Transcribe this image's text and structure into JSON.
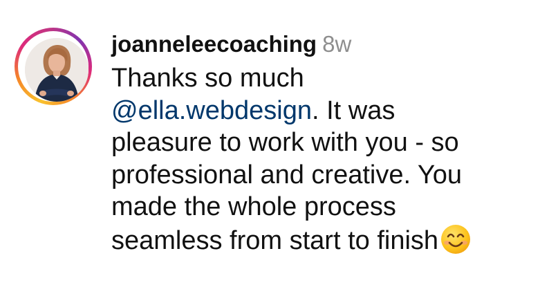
{
  "comment": {
    "username": "joanneleecoaching",
    "timestamp": "8w",
    "avatar_icon": "profile-photo-avatar",
    "line1": "Thanks so much",
    "mention": "@ella.webdesign",
    "line2_rest": ". It was",
    "line3": "pleasure to work with you - so",
    "line4": "professional and creative. You",
    "line5": "made the whole process",
    "line6": "seamless from start to finish",
    "emoji_icon": "smiling-face-emoji-icon",
    "mention_color": "#00376b",
    "timestamp_color": "#8e8e8e",
    "story_ring_colors": [
      "#f9c22e",
      "#f58529",
      "#dd2a7b",
      "#8134af"
    ]
  }
}
